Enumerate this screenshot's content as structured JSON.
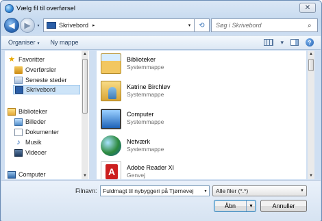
{
  "window": {
    "title": "Vælg fil til overførsel",
    "close_glyph": "✕"
  },
  "address": {
    "crumb": "Skrivebord",
    "separator": "▸",
    "dropdown": "▾",
    "search_placeholder": "Søg i Skrivebord"
  },
  "toolbar": {
    "organize_label": "Organiser",
    "new_folder_label": "Ny mappe",
    "caret": "▾"
  },
  "nav": {
    "items": [
      {
        "label": "Favoritter",
        "icon": "star-icon"
      },
      {
        "label": "Overførsler",
        "icon": "downloads-icon"
      },
      {
        "label": "Seneste steder",
        "icon": "recent-places-icon"
      },
      {
        "label": "Skrivebord",
        "icon": "desktop-icon",
        "selected": true
      },
      {
        "label": "Biblioteker",
        "icon": "libraries-icon"
      },
      {
        "label": "Billeder",
        "icon": "pictures-icon"
      },
      {
        "label": "Dokumenter",
        "icon": "documents-icon"
      },
      {
        "label": "Musik",
        "icon": "music-icon"
      },
      {
        "label": "Videoer",
        "icon": "videos-icon"
      },
      {
        "label": "Computer",
        "icon": "computer-icon"
      }
    ]
  },
  "files": [
    {
      "name": "Biblioteker",
      "type": "Systemmappe",
      "icon": "libraries-folder-icon"
    },
    {
      "name": "Katrine Birchløv",
      "type": "Systemmappe",
      "icon": "user-folder-icon"
    },
    {
      "name": "Computer",
      "type": "Systemmappe",
      "icon": "computer-icon"
    },
    {
      "name": "Netværk",
      "type": "Systemmappe",
      "icon": "network-icon"
    },
    {
      "name": "Adobe Reader XI",
      "type": "Genvej",
      "icon": "adobe-reader-icon"
    }
  ],
  "bottom": {
    "filename_label": "Filnavn:",
    "filename_value": "Fuldmagt til nybyggeri på Tjørnevej",
    "filetype_value": "Alle filer (*.*)",
    "open_label": "Åbn",
    "cancel_label": "Annuller"
  }
}
